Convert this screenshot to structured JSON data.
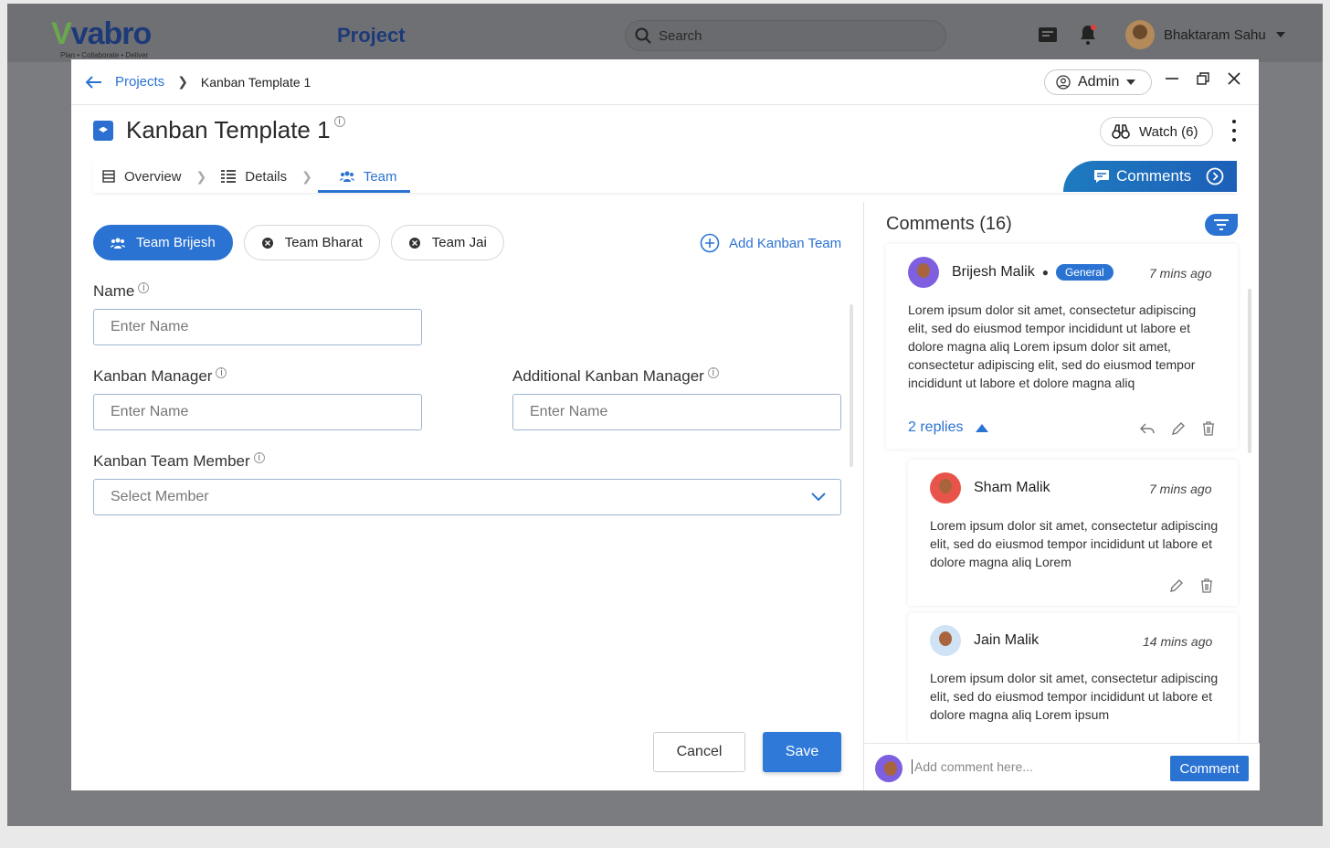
{
  "app": {
    "logo_text": "vabro",
    "logo_tagline": "Plan • Collaborate • Deliver",
    "section_title": "Project",
    "search_placeholder": "Search",
    "user_name": "Bhaktaram Sahu"
  },
  "breadcrumb": {
    "parent": "Projects",
    "current": "Kanban Template 1"
  },
  "role": {
    "label": "Admin"
  },
  "header": {
    "title": "Kanban Template 1",
    "watch_label": "Watch (6)"
  },
  "tabs": [
    {
      "label": "Overview",
      "icon": "list-icon"
    },
    {
      "label": "Details",
      "icon": "details-icon"
    },
    {
      "label": "Team",
      "icon": "team-icon",
      "active": true
    }
  ],
  "comments_tab_label": "Comments",
  "teams": {
    "items": [
      "Team Brijesh",
      "Team Bharat",
      "Team Jai"
    ],
    "active": "Team Brijesh",
    "add_label": "Add Kanban Team"
  },
  "form": {
    "name_label": "Name",
    "name_placeholder": "Enter Name",
    "manager_label": "Kanban Manager",
    "manager_placeholder": "Enter Name",
    "add_manager_label": "Additional Kanban Manager",
    "add_manager_placeholder": "Enter Name",
    "member_label": "Kanban Team Member",
    "member_placeholder": "Select Member",
    "cancel_label": "Cancel",
    "save_label": "Save"
  },
  "comments": {
    "title": "Comments (16)",
    "items": [
      {
        "author": "Brijesh Malik",
        "tag": "General",
        "time": "7 mins ago",
        "text": "Lorem ipsum dolor sit amet, consectetur adipiscing elit, sed do eiusmod tempor incididunt ut labore et dolore magna aliq Lorem ipsum dolor sit amet, consectetur adipiscing elit, sed do eiusmod tempor incididunt ut labore et dolore magna aliq",
        "replies_label": "2 replies"
      },
      {
        "author": "Sham Malik",
        "time": "7 mins ago",
        "text": "Lorem ipsum dolor sit amet, consectetur adipiscing elit, sed do eiusmod tempor incididunt ut labore et dolore magna aliq Lorem"
      },
      {
        "author": "Jain Malik",
        "time": "14 mins ago",
        "text": "Lorem ipsum dolor sit amet, consectetur adipiscing elit, sed do eiusmod tempor incididunt ut labore et dolore magna aliq Lorem ipsum"
      }
    ],
    "input_placeholder": "Add comment here...",
    "submit_label": "Comment"
  },
  "colors": {
    "accent": "#2b73d2",
    "brand_dark": "#1d3a78",
    "brand_green": "#6aa84f"
  }
}
